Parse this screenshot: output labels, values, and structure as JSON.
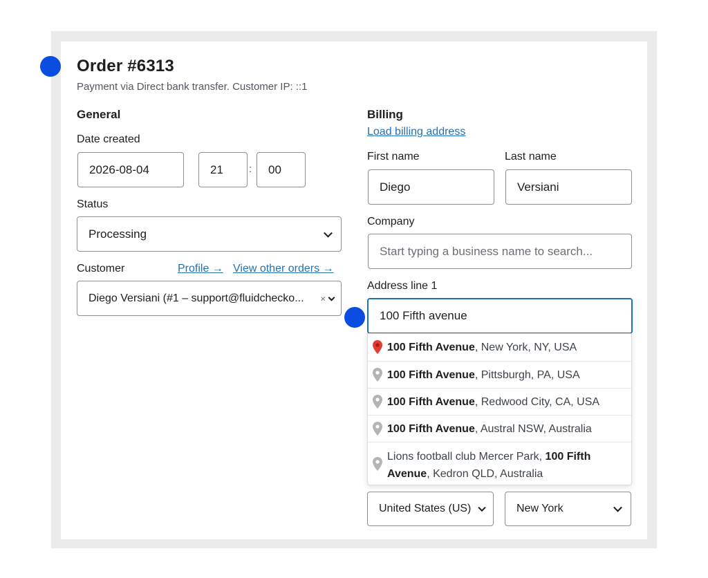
{
  "order": {
    "title": "Order #6313",
    "subtitle": "Payment via Direct bank transfer. Customer IP: ::1"
  },
  "general": {
    "heading": "General",
    "date_label": "Date created",
    "date_value": "2026-08-04",
    "hour_value": "21",
    "time_separator": ":",
    "minute_value": "00",
    "status_label": "Status",
    "status_value": "Processing",
    "customer_label": "Customer",
    "profile_link": "Profile →",
    "view_orders_link": "View other orders →",
    "customer_value": "Diego Versiani (#1 – support@fluidchecko...",
    "customer_clear": "×"
  },
  "billing": {
    "heading": "Billing",
    "load_link": "Load billing address",
    "first_name_label": "First name",
    "first_name_value": "Diego",
    "last_name_label": "Last name",
    "last_name_value": "Versiani",
    "company_label": "Company",
    "company_placeholder": "Start typing a business name to search...",
    "address1_label": "Address line 1",
    "address1_value": "100 Fifth avenue",
    "country_value": "United States (US)",
    "state_value": "New York"
  },
  "suggestions": [
    {
      "bold": "100 Fifth Avenue",
      "rest": ", New York, NY, USA",
      "pin_color": "#e23b32"
    },
    {
      "bold": "100 Fifth Avenue",
      "rest": ", Pittsburgh, PA, USA",
      "pin_color": "#b4b4b4"
    },
    {
      "bold": "100 Fifth Avenue",
      "rest": ", Redwood City, CA, USA",
      "pin_color": "#b4b4b4"
    },
    {
      "bold": "100 Fifth Avenue",
      "rest": ", Austral NSW, Australia",
      "pin_color": "#b4b4b4"
    },
    {
      "prefix": "Lions football club Mercer Park, ",
      "bold": "100 Fifth Avenue",
      "rest": ", Kedron QLD, Australia",
      "pin_color": "#b4b4b4"
    }
  ],
  "colors": {
    "accent": "#2271b1",
    "marker": "#0a4de0"
  }
}
